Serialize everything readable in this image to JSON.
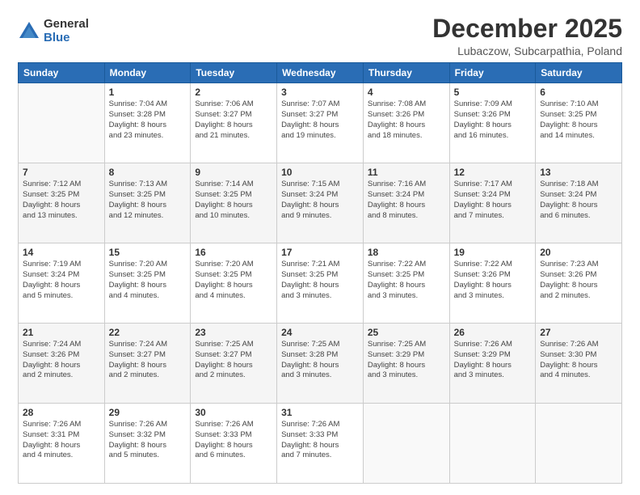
{
  "logo": {
    "general": "General",
    "blue": "Blue"
  },
  "title": "December 2025",
  "subtitle": "Lubaczow, Subcarpathia, Poland",
  "days_header": [
    "Sunday",
    "Monday",
    "Tuesday",
    "Wednesday",
    "Thursday",
    "Friday",
    "Saturday"
  ],
  "weeks": [
    [
      {
        "num": "",
        "info": ""
      },
      {
        "num": "1",
        "info": "Sunrise: 7:04 AM\nSunset: 3:28 PM\nDaylight: 8 hours\nand 23 minutes."
      },
      {
        "num": "2",
        "info": "Sunrise: 7:06 AM\nSunset: 3:27 PM\nDaylight: 8 hours\nand 21 minutes."
      },
      {
        "num": "3",
        "info": "Sunrise: 7:07 AM\nSunset: 3:27 PM\nDaylight: 8 hours\nand 19 minutes."
      },
      {
        "num": "4",
        "info": "Sunrise: 7:08 AM\nSunset: 3:26 PM\nDaylight: 8 hours\nand 18 minutes."
      },
      {
        "num": "5",
        "info": "Sunrise: 7:09 AM\nSunset: 3:26 PM\nDaylight: 8 hours\nand 16 minutes."
      },
      {
        "num": "6",
        "info": "Sunrise: 7:10 AM\nSunset: 3:25 PM\nDaylight: 8 hours\nand 14 minutes."
      }
    ],
    [
      {
        "num": "7",
        "info": "Sunrise: 7:12 AM\nSunset: 3:25 PM\nDaylight: 8 hours\nand 13 minutes."
      },
      {
        "num": "8",
        "info": "Sunrise: 7:13 AM\nSunset: 3:25 PM\nDaylight: 8 hours\nand 12 minutes."
      },
      {
        "num": "9",
        "info": "Sunrise: 7:14 AM\nSunset: 3:25 PM\nDaylight: 8 hours\nand 10 minutes."
      },
      {
        "num": "10",
        "info": "Sunrise: 7:15 AM\nSunset: 3:24 PM\nDaylight: 8 hours\nand 9 minutes."
      },
      {
        "num": "11",
        "info": "Sunrise: 7:16 AM\nSunset: 3:24 PM\nDaylight: 8 hours\nand 8 minutes."
      },
      {
        "num": "12",
        "info": "Sunrise: 7:17 AM\nSunset: 3:24 PM\nDaylight: 8 hours\nand 7 minutes."
      },
      {
        "num": "13",
        "info": "Sunrise: 7:18 AM\nSunset: 3:24 PM\nDaylight: 8 hours\nand 6 minutes."
      }
    ],
    [
      {
        "num": "14",
        "info": "Sunrise: 7:19 AM\nSunset: 3:24 PM\nDaylight: 8 hours\nand 5 minutes."
      },
      {
        "num": "15",
        "info": "Sunrise: 7:20 AM\nSunset: 3:25 PM\nDaylight: 8 hours\nand 4 minutes."
      },
      {
        "num": "16",
        "info": "Sunrise: 7:20 AM\nSunset: 3:25 PM\nDaylight: 8 hours\nand 4 minutes."
      },
      {
        "num": "17",
        "info": "Sunrise: 7:21 AM\nSunset: 3:25 PM\nDaylight: 8 hours\nand 3 minutes."
      },
      {
        "num": "18",
        "info": "Sunrise: 7:22 AM\nSunset: 3:25 PM\nDaylight: 8 hours\nand 3 minutes."
      },
      {
        "num": "19",
        "info": "Sunrise: 7:22 AM\nSunset: 3:26 PM\nDaylight: 8 hours\nand 3 minutes."
      },
      {
        "num": "20",
        "info": "Sunrise: 7:23 AM\nSunset: 3:26 PM\nDaylight: 8 hours\nand 2 minutes."
      }
    ],
    [
      {
        "num": "21",
        "info": "Sunrise: 7:24 AM\nSunset: 3:26 PM\nDaylight: 8 hours\nand 2 minutes."
      },
      {
        "num": "22",
        "info": "Sunrise: 7:24 AM\nSunset: 3:27 PM\nDaylight: 8 hours\nand 2 minutes."
      },
      {
        "num": "23",
        "info": "Sunrise: 7:25 AM\nSunset: 3:27 PM\nDaylight: 8 hours\nand 2 minutes."
      },
      {
        "num": "24",
        "info": "Sunrise: 7:25 AM\nSunset: 3:28 PM\nDaylight: 8 hours\nand 3 minutes."
      },
      {
        "num": "25",
        "info": "Sunrise: 7:25 AM\nSunset: 3:29 PM\nDaylight: 8 hours\nand 3 minutes."
      },
      {
        "num": "26",
        "info": "Sunrise: 7:26 AM\nSunset: 3:29 PM\nDaylight: 8 hours\nand 3 minutes."
      },
      {
        "num": "27",
        "info": "Sunrise: 7:26 AM\nSunset: 3:30 PM\nDaylight: 8 hours\nand 4 minutes."
      }
    ],
    [
      {
        "num": "28",
        "info": "Sunrise: 7:26 AM\nSunset: 3:31 PM\nDaylight: 8 hours\nand 4 minutes."
      },
      {
        "num": "29",
        "info": "Sunrise: 7:26 AM\nSunset: 3:32 PM\nDaylight: 8 hours\nand 5 minutes."
      },
      {
        "num": "30",
        "info": "Sunrise: 7:26 AM\nSunset: 3:33 PM\nDaylight: 8 hours\nand 6 minutes."
      },
      {
        "num": "31",
        "info": "Sunrise: 7:26 AM\nSunset: 3:33 PM\nDaylight: 8 hours\nand 7 minutes."
      },
      {
        "num": "",
        "info": ""
      },
      {
        "num": "",
        "info": ""
      },
      {
        "num": "",
        "info": ""
      }
    ]
  ]
}
